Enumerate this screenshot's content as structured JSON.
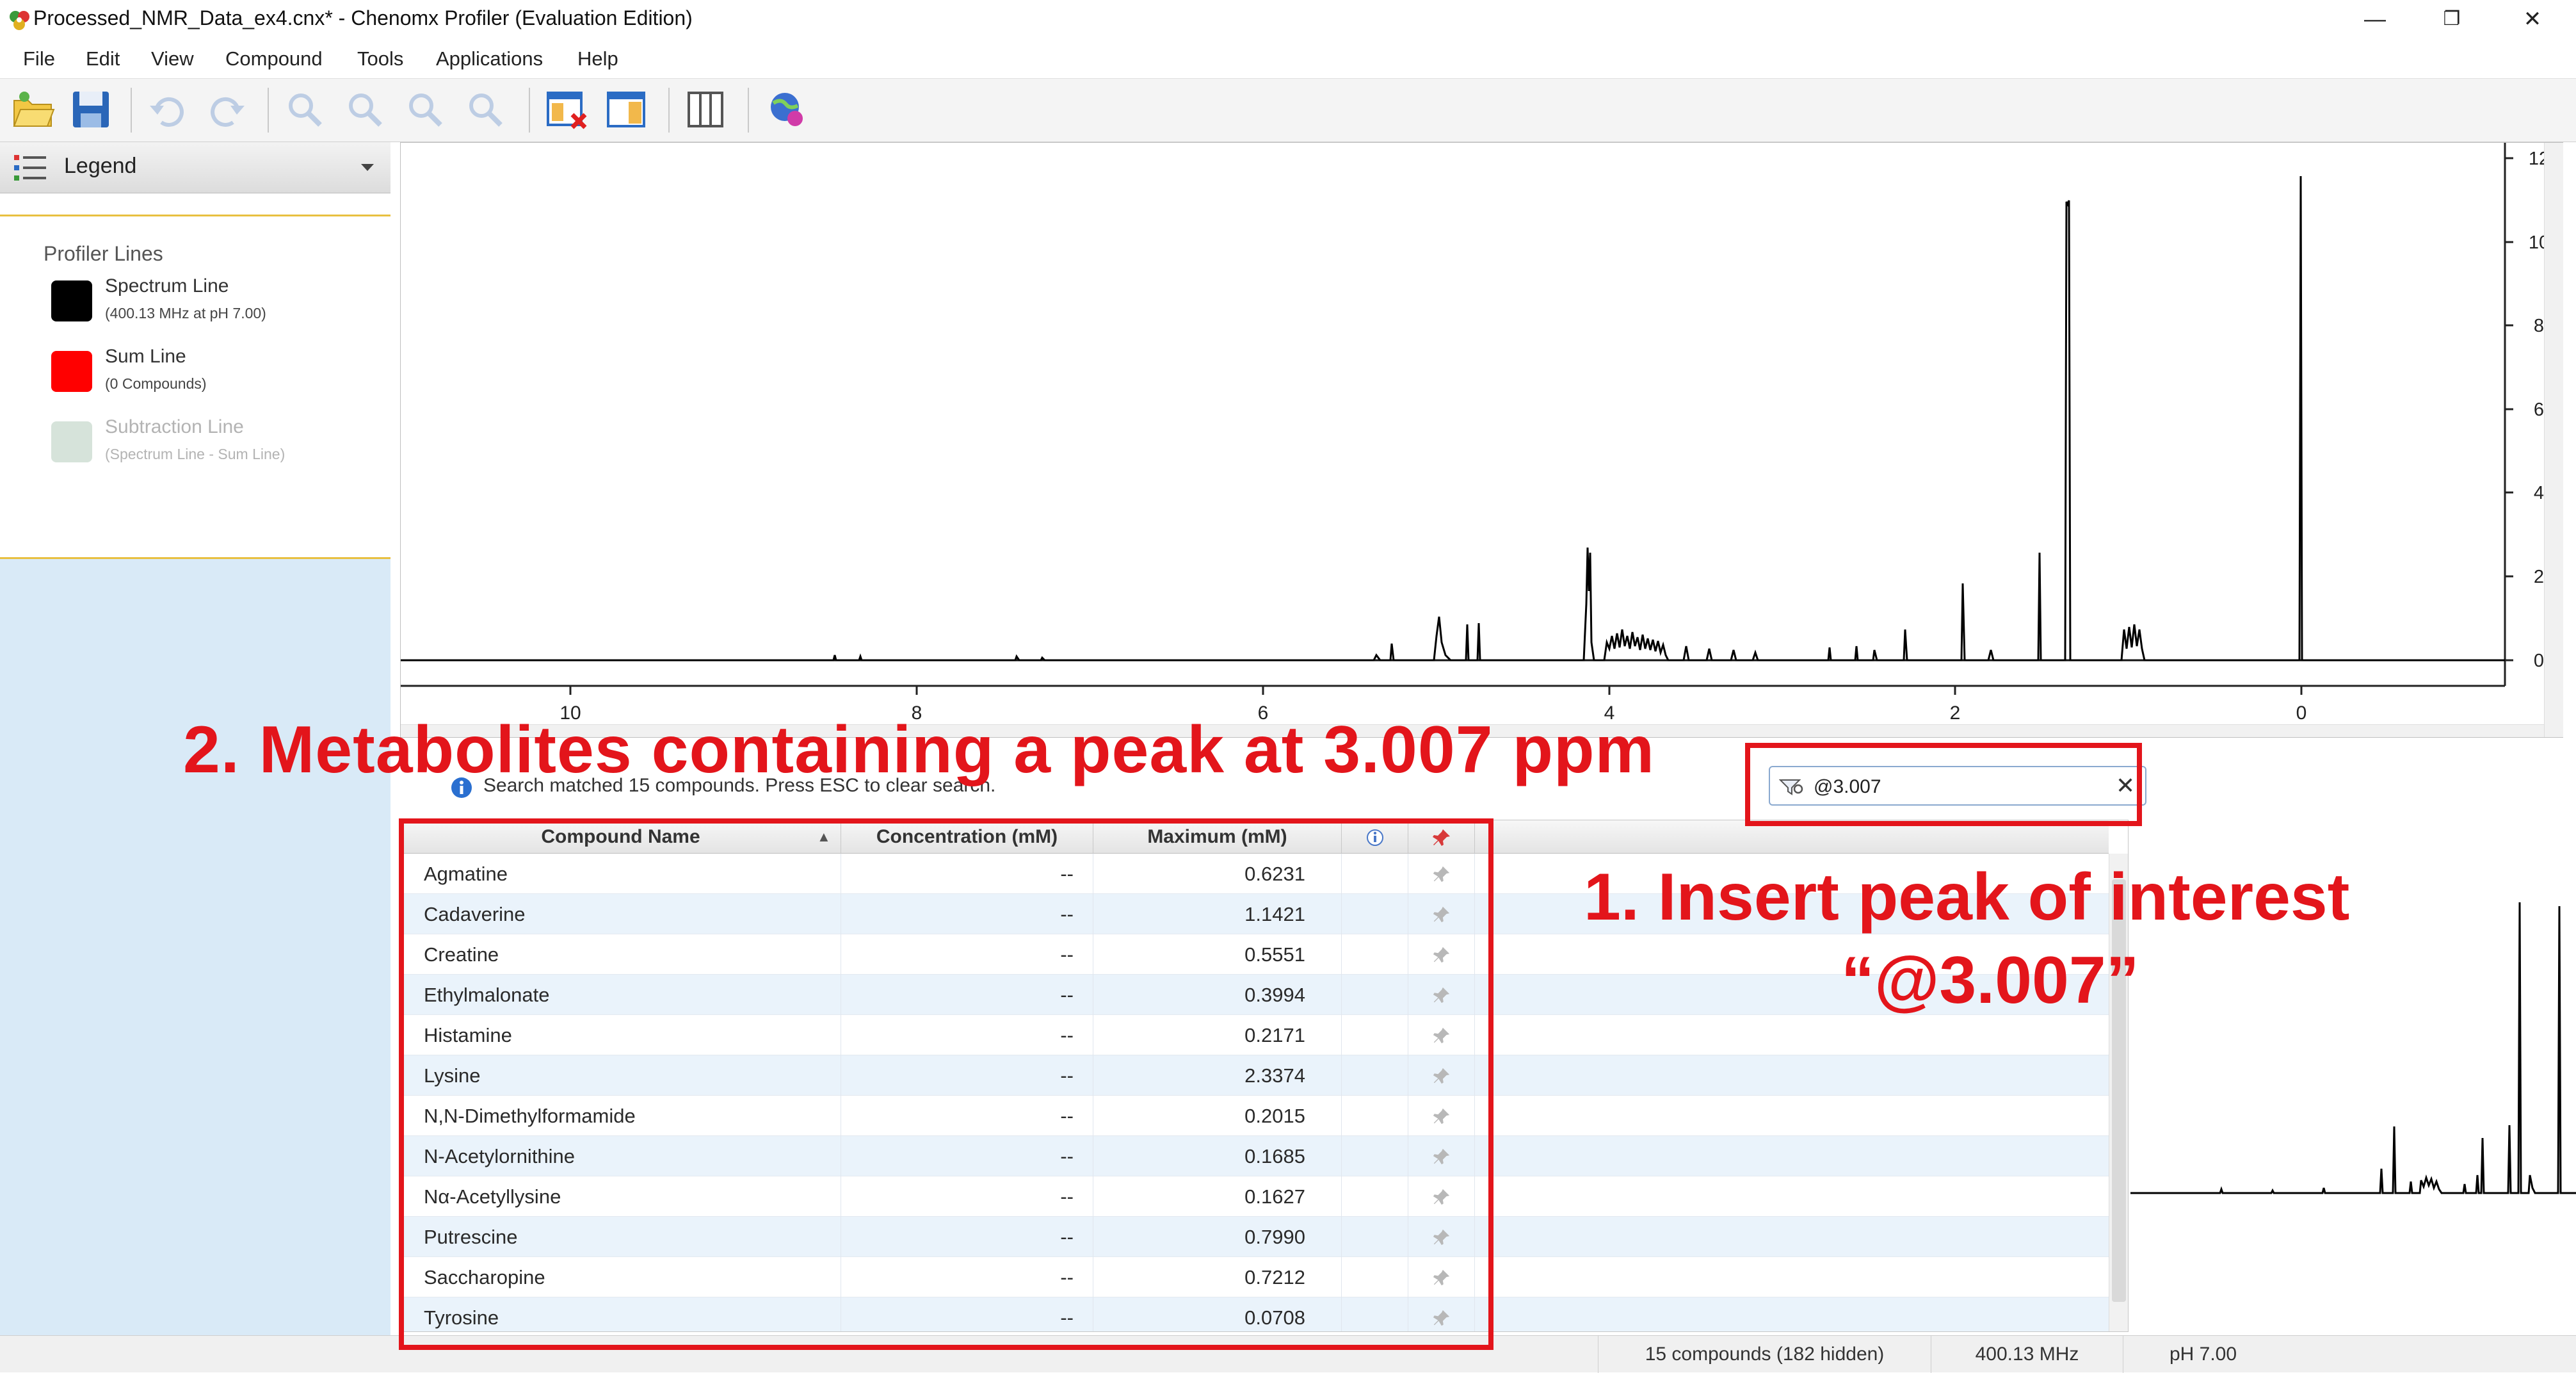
{
  "window": {
    "title": "Processed_NMR_Data_ex4.cnx* - Chenomx Profiler (Evaluation Edition)",
    "minimize_glyph": "—",
    "restore_glyph": "❐",
    "close_glyph": "✕"
  },
  "menu": [
    "File",
    "Edit",
    "View",
    "Compound",
    "Tools",
    "Applications",
    "Help"
  ],
  "toolbar": {
    "icons": [
      "open-folder-icon",
      "save-icon",
      "undo-icon",
      "redo-icon",
      "zoom-in-icon",
      "zoom-out-icon",
      "zoom-fit-icon",
      "zoom-reset-icon",
      "remove-compound-icon",
      "panel-layout-icon",
      "split-view-icon",
      "globe-icon"
    ]
  },
  "legend": {
    "header_label": "Legend",
    "section_title": "Profiler Lines",
    "items": [
      {
        "label": "Spectrum Line",
        "sub": "(400.13 MHz at pH 7.00)",
        "color": "#000000",
        "disabled": false
      },
      {
        "label": "Sum Line",
        "sub": "(0 Compounds)",
        "color": "#ff0000",
        "disabled": false
      },
      {
        "label": "Subtraction Line",
        "sub": "(Spectrum Line  - Sum Line)",
        "color": "#d6e3da",
        "disabled": true
      }
    ]
  },
  "spectrum": {
    "x_ticks": [
      "10",
      "8",
      "6",
      "4",
      "2",
      "0"
    ],
    "y_ticks": [
      "12",
      "10",
      "8",
      "6",
      "4",
      "2",
      "0"
    ],
    "line_color": "#000000"
  },
  "search": {
    "info_text": "Search matched 15 compounds.  Press ESC to clear search.",
    "value": "@3.007",
    "clear_glyph": "✕"
  },
  "table": {
    "columns": [
      "Compound Name",
      "Concentration (mM)",
      "Maximum (mM)",
      "i",
      ""
    ],
    "sort_glyph": "▲",
    "rows": [
      {
        "name": "Agmatine",
        "conc": "--",
        "max": "0.6231"
      },
      {
        "name": "Cadaverine",
        "conc": "--",
        "max": "1.1421"
      },
      {
        "name": "Creatine",
        "conc": "--",
        "max": "0.5551"
      },
      {
        "name": "Ethylmalonate",
        "conc": "--",
        "max": "0.3994"
      },
      {
        "name": "Histamine",
        "conc": "--",
        "max": "0.2171"
      },
      {
        "name": "Lysine",
        "conc": "--",
        "max": "2.3374"
      },
      {
        "name": "N,N-Dimethylformamide",
        "conc": "--",
        "max": "0.2015"
      },
      {
        "name": "N-Acetylornithine",
        "conc": "--",
        "max": "0.1685"
      },
      {
        "name": "Nα-Acetyllysine",
        "conc": "--",
        "max": "0.1627"
      },
      {
        "name": "Putrescine",
        "conc": "--",
        "max": "0.7990"
      },
      {
        "name": "Saccharopine",
        "conc": "--",
        "max": "0.7212"
      },
      {
        "name": "Tyrosine",
        "conc": "--",
        "max": "0.0708"
      }
    ]
  },
  "status": {
    "compounds": "15 compounds (182 hidden)",
    "frequency": "400.13 MHz",
    "ph": "pH 7.00"
  },
  "annotations": {
    "step1_line1": "1.  Insert peak of interest",
    "step1_line2": "“@3.007”",
    "step2": "2. Metabolites containing a peak at 3.007 ppm",
    "color": "#e3151b"
  }
}
